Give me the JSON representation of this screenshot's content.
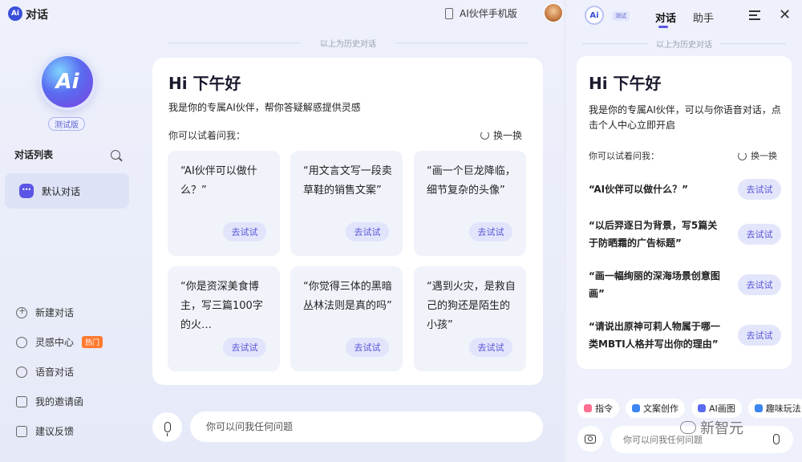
{
  "app": {
    "title": "对话",
    "logo_text": "Ai",
    "phone_label": "AI伙伴手机版"
  },
  "sidebar": {
    "logo_text": "Ai",
    "beta_label": "测试版",
    "conv_list_label": "对话列表",
    "default_conv_label": "默认对话",
    "menu": [
      {
        "label": "新建对话",
        "icon": "plus-circle-icon"
      },
      {
        "label": "灵感中心",
        "icon": "bulb-icon",
        "badge": "热门"
      },
      {
        "label": "语音对话",
        "icon": "headphones-icon"
      },
      {
        "label": "我的邀请函",
        "icon": "mail-icon"
      },
      {
        "label": "建议反馈",
        "icon": "feedback-icon"
      }
    ]
  },
  "main": {
    "history_divider": "以上为历史对话",
    "greeting": "Hi 下午好",
    "intro": "我是你的专属AI伙伴，帮你答疑解惑提供灵感",
    "try_label": "你可以试着问我：",
    "refresh_label": "换一换",
    "suggestions": [
      {
        "text": "“AI伙伴可以做什么？”",
        "btn": "去试试"
      },
      {
        "text": "“用文言文写一段卖草鞋的销售文案”",
        "btn": "去试试"
      },
      {
        "text": "“画一个巨龙降临，细节复杂的头像”",
        "btn": "去试试"
      },
      {
        "text": "“你是资深美食博主，写三篇100字的火…",
        "btn": "去试试"
      },
      {
        "text": "“你觉得三体的黑暗丛林法则是真的吗”",
        "btn": "去试试"
      },
      {
        "text": "“遇到火灾，是救自己的狗还是陌生的小孩”",
        "btn": "去试试"
      }
    ],
    "input_placeholder": "你可以问我任何问题"
  },
  "right_panel": {
    "logo_text": "Ai",
    "beta_label": "测试",
    "tabs": [
      {
        "label": "对话",
        "active": true
      },
      {
        "label": "助手",
        "active": false
      }
    ],
    "close_label": "✕",
    "history_divider": "以上为历史对话",
    "greeting": "Hi 下午好",
    "intro": "我是你的专属AI伙伴，可以与你语音对话，点击个人中心立即开启",
    "try_label": "你可以试着问我：",
    "refresh_label": "换一换",
    "suggestions": [
      {
        "text": "“AI伙伴可以做什么？”",
        "btn": "去试试"
      },
      {
        "text": "“以后羿逐日为背景，写5篇关于防晒霜的广告标题”",
        "btn": "去试试"
      },
      {
        "text": "“画一幅绚丽的深海场景创意图画”",
        "btn": "去试试"
      },
      {
        "text": "“请说出原神可莉人物属于哪一类MBTI人格并写出你的理由”",
        "btn": "去试试"
      }
    ],
    "chips": [
      {
        "label": "指令",
        "color": "#ff6f91"
      },
      {
        "label": "文案创作",
        "color": "#3b86f0"
      },
      {
        "label": "AI画图",
        "color": "#5b6cf0"
      },
      {
        "label": "趣味玩法",
        "color": "#3b86f0"
      }
    ],
    "input_placeholder": "你可以问我任何问题"
  },
  "watermark": {
    "brand": "新智元"
  },
  "colors": {
    "accent": "#5b55e6",
    "try_button_bg": "#e1e4fb",
    "hot_badge": "#ff7a2f"
  }
}
